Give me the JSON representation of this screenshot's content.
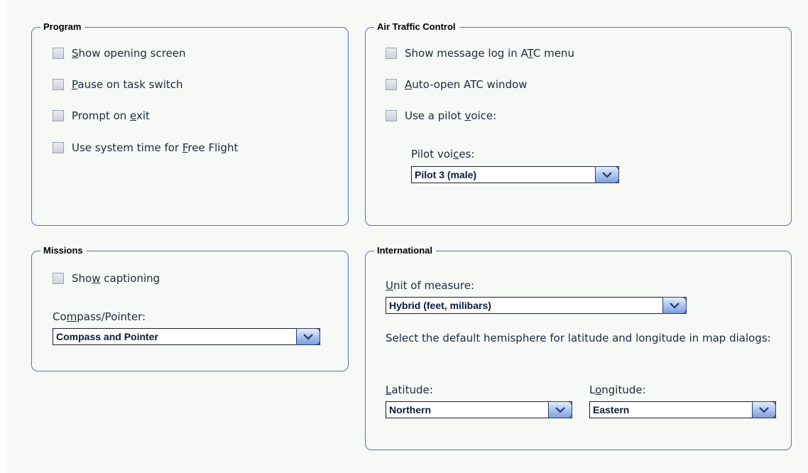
{
  "program": {
    "title": "Program",
    "show_opening_screen": {
      "pre": "",
      "key": "S",
      "post": "how opening screen",
      "checked": false
    },
    "pause_on_task_switch": {
      "pre": "",
      "key": "P",
      "post": "ause on task switch",
      "checked": false
    },
    "prompt_on_exit": {
      "pre": "Prompt on ",
      "key": "e",
      "post": "xit",
      "checked": false
    },
    "use_system_time": {
      "pre": "Use system time for ",
      "key": "F",
      "post": "ree Flight",
      "checked": false
    }
  },
  "atc": {
    "title": "Air Traffic Control",
    "show_message_log": {
      "pre": "Show message log in A",
      "key": "T",
      "post": "C menu",
      "checked": false
    },
    "auto_open_window": {
      "pre": "",
      "key": "A",
      "post": "uto-open ATC window",
      "checked": false
    },
    "use_pilot_voice": {
      "pre": "Use a pilot ",
      "key": "v",
      "post": "oice:",
      "checked": false
    },
    "pilot_voices_label": {
      "pre": "Pilot voi",
      "key": "c",
      "post": "es:"
    },
    "pilot_voices_value": "Pilot 3 (male)"
  },
  "missions": {
    "title": "Missions",
    "show_captioning": {
      "pre": "Sho",
      "key": "w",
      "post": " captioning",
      "checked": false
    },
    "compass_label": {
      "pre": "Co",
      "key": "m",
      "post": "pass/Pointer:"
    },
    "compass_value": "Compass and Pointer"
  },
  "international": {
    "title": "International",
    "unit_label": {
      "pre": "",
      "key": "U",
      "post": "nit of measure:"
    },
    "unit_value": "Hybrid (feet, milibars)",
    "hemisphere_text": "Select the default hemisphere for latitude and longitude in map dialogs:",
    "latitude_label": {
      "pre": "",
      "key": "L",
      "post": "atitude:"
    },
    "latitude_value": "Northern",
    "longitude_label": {
      "pre": "L",
      "key": "o",
      "post": "ngitude:"
    },
    "longitude_value": "Eastern"
  }
}
